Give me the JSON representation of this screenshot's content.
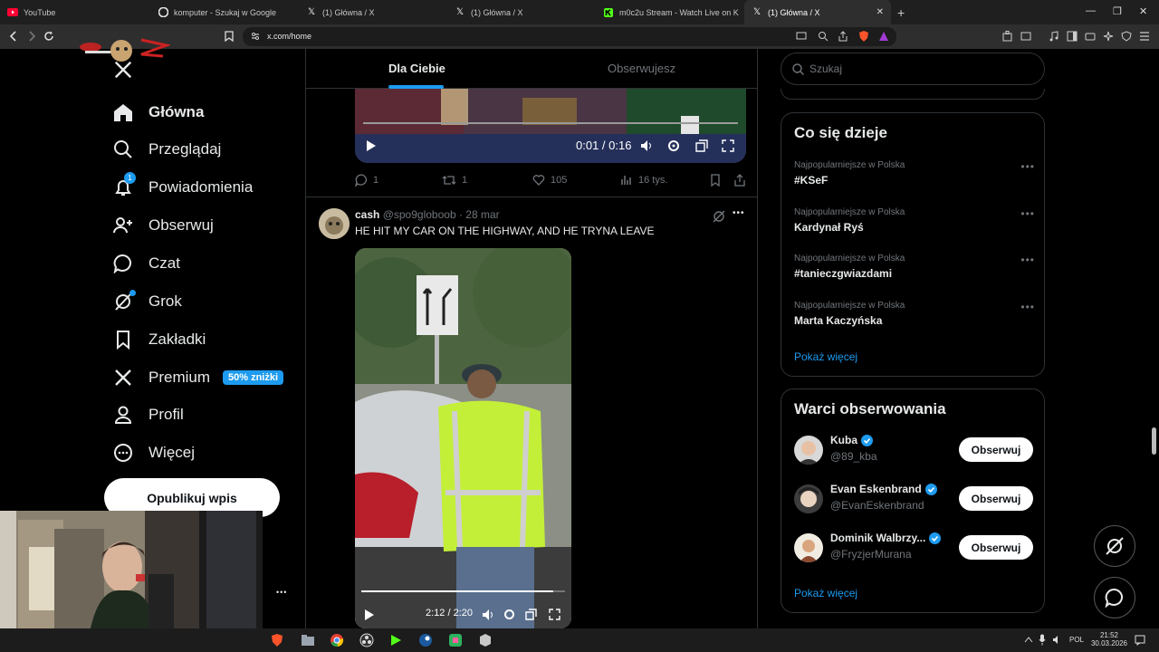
{
  "browser": {
    "tabs": [
      {
        "title": "YouTube",
        "icon": "youtube-icon"
      },
      {
        "title": "komputer - Szukaj w Google",
        "icon": "google-icon"
      },
      {
        "title": "(1) Główna / X",
        "icon": "x-icon"
      },
      {
        "title": "(1) Główna / X",
        "icon": "x-icon"
      },
      {
        "title": "m0c2u Stream - Watch Live on K",
        "icon": "kick-icon"
      },
      {
        "title": "(1) Główna / X",
        "icon": "x-icon"
      }
    ],
    "url": "x.com/home",
    "new_tab": "+",
    "win_min": "—",
    "win_restore": "❐",
    "win_close": "✕",
    "tab_close": "✕"
  },
  "nav": {
    "items": [
      {
        "label": "Główna",
        "icon": "home-icon"
      },
      {
        "label": "Przeglądaj",
        "icon": "search-icon"
      },
      {
        "label": "Powiadomienia",
        "icon": "bell-icon",
        "badge": "1"
      },
      {
        "label": "Obserwuj",
        "icon": "follow-icon"
      },
      {
        "label": "Czat",
        "icon": "chat-icon"
      },
      {
        "label": "Grok",
        "icon": "grok-icon"
      },
      {
        "label": "Zakładki",
        "icon": "bookmark-icon"
      },
      {
        "label": "Premium",
        "icon": "x-logo-icon",
        "badge": "50% zniżki"
      },
      {
        "label": "Profil",
        "icon": "person-icon"
      },
      {
        "label": "Więcej",
        "icon": "more-circle-icon"
      }
    ],
    "post_button": "Opublikuj wpis",
    "more_dots": "•••"
  },
  "feed": {
    "tabs": [
      "Dla Ciebie",
      "Obserwujesz"
    ],
    "tweet1": {
      "video_time": "0:01 / 0:16",
      "replies": "1",
      "reposts": "1",
      "likes": "105",
      "views": "16 tys."
    },
    "tweet2": {
      "name": "cash",
      "handle": "@spo9globoob",
      "date": "· 28 mar",
      "text": "HE HIT MY CAR ON THE HIGHWAY, AND HE TRYNA LEAVE",
      "video_time": "2:12 / 2:20",
      "video_progress": 0.94,
      "more": "•••"
    }
  },
  "right": {
    "search_placeholder": "Szukaj",
    "trends_title": "Co się dzieje",
    "trends": [
      {
        "context": "Najpopularniejsze w Polska",
        "name": "#KSeF"
      },
      {
        "context": "Najpopularniejsze w Polska",
        "name": "Kardynał Ryś"
      },
      {
        "context": "Najpopularniejsze w Polska",
        "name": "#tanieczgwiazdami"
      },
      {
        "context": "Najpopularniejsze w Polska",
        "name": "Marta Kaczyńska"
      }
    ],
    "trends_more": "•••",
    "show_more": "Pokaż więcej",
    "who_title": "Warci obserwowania",
    "who": [
      {
        "name": "Kuba",
        "handle": "@89_kba",
        "button": "Obserwuj"
      },
      {
        "name": "Evan Eskenbrand",
        "handle": "@EvanEskenbrand",
        "button": "Obserwuj"
      },
      {
        "name": "Dominik Walbrzy...",
        "handle": "@FryzjerMurana",
        "button": "Obserwuj"
      }
    ],
    "who_more": "Pokaż więcej"
  },
  "taskbar": {
    "lang": "POL",
    "time": "21:52",
    "date": "30.03.2026"
  },
  "colors": {
    "accent": "#1d9bf0",
    "background": "#000000",
    "border": "#2f3336",
    "muted": "#71767b"
  }
}
